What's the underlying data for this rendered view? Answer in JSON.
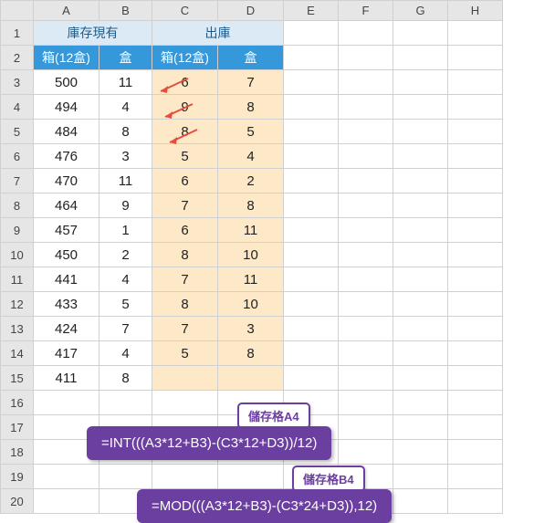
{
  "columns": [
    "A",
    "B",
    "C",
    "D",
    "E",
    "F",
    "G",
    "H"
  ],
  "rows": [
    "1",
    "2",
    "3",
    "4",
    "5",
    "6",
    "7",
    "8",
    "9",
    "10",
    "11",
    "12",
    "13",
    "14",
    "15",
    "16",
    "17",
    "18",
    "19",
    "20"
  ],
  "header1": {
    "left": "庫存現有",
    "right": "出庫"
  },
  "header2": {
    "a": "箱(12盒)",
    "b": "盒",
    "c": "箱(12盒)",
    "d": "盒"
  },
  "data": [
    {
      "a": "500",
      "b": "11",
      "c": "6",
      "d": "7"
    },
    {
      "a": "494",
      "b": "4",
      "c": "9",
      "d": "8"
    },
    {
      "a": "484",
      "b": "8",
      "c": "8",
      "d": "5"
    },
    {
      "a": "476",
      "b": "3",
      "c": "5",
      "d": "4"
    },
    {
      "a": "470",
      "b": "11",
      "c": "6",
      "d": "2"
    },
    {
      "a": "464",
      "b": "9",
      "c": "7",
      "d": "8"
    },
    {
      "a": "457",
      "b": "1",
      "c": "6",
      "d": "11"
    },
    {
      "a": "450",
      "b": "2",
      "c": "8",
      "d": "10"
    },
    {
      "a": "441",
      "b": "4",
      "c": "7",
      "d": "11"
    },
    {
      "a": "433",
      "b": "5",
      "c": "8",
      "d": "10"
    },
    {
      "a": "424",
      "b": "7",
      "c": "7",
      "d": "3"
    },
    {
      "a": "417",
      "b": "4",
      "c": "5",
      "d": "8"
    },
    {
      "a": "411",
      "b": "8",
      "c": "",
      "d": ""
    }
  ],
  "formula1": {
    "label": "儲存格A4",
    "text": "=INT(((A3*12+B3)-(C3*12+D3))/12)"
  },
  "formula2": {
    "label": "儲存格B4",
    "text": "=MOD(((A3*12+B3)-(C3*24+D3)),12)"
  }
}
